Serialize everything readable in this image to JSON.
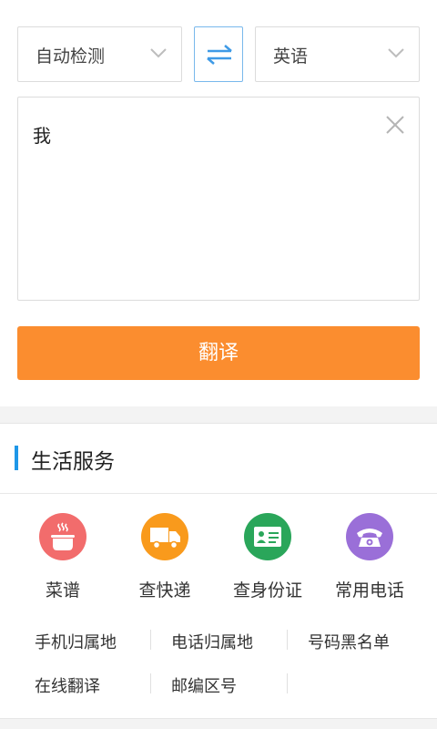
{
  "translator": {
    "source_lang": "自动检测",
    "target_lang": "英语",
    "input_text": "我",
    "translate_label": "翻译"
  },
  "life_services": {
    "title": "生活服务",
    "accent": "#1e97e8",
    "icons": [
      {
        "label": "菜谱",
        "icon": "cooking-pot-icon",
        "color": "#f26c6c"
      },
      {
        "label": "查快递",
        "icon": "delivery-truck-icon",
        "color": "#f99a1c"
      },
      {
        "label": "查身份证",
        "icon": "id-card-icon",
        "color": "#2aa65a"
      },
      {
        "label": "常用电话",
        "icon": "telephone-icon",
        "color": "#9a6fd8"
      }
    ],
    "links": [
      "手机归属地",
      "电话归属地",
      "号码黑名单",
      "在线翻译",
      "邮编区号"
    ]
  },
  "colors": {
    "translate_button": "#fb8d2f",
    "swap_border": "#79b8ec",
    "swap_arrows": "#3f9ae6"
  }
}
